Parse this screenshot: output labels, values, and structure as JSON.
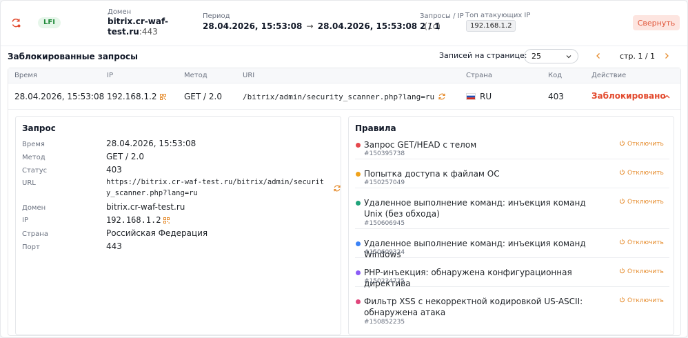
{
  "header": {
    "attack_type": "LFI",
    "domain_label": "Домен",
    "domain_name": "bitrix.cr-waf-test.ru",
    "domain_port": ":443",
    "period_label": "Период",
    "period_start": "28.04.2026, 15:53:08",
    "period_arrow": "→",
    "period_end": "28.04.2026, 15:53:08",
    "period_duration": "(1с)",
    "requests_label": "Запросы / IP",
    "requests_value": "2 / 1",
    "top_ip_label": "Топ атакующих IP",
    "top_ip": "192.168.1.2",
    "collapse_button": "Свернуть"
  },
  "blocked": {
    "title": "Заблокированные запросы",
    "per_page_label": "Записей на странице:",
    "per_page_value": "25",
    "page_text": "стр. 1 / 1"
  },
  "table": {
    "columns": [
      "Время",
      "IP",
      "Метод",
      "URI",
      "Страна",
      "Код",
      "Действие"
    ],
    "row": {
      "time": "28.04.2026, 15:53:08",
      "ip": "192.168.1.2",
      "method": "GET / 2.0",
      "uri": "/bitrix/admin/security_scanner.php?lang=ru",
      "country": "RU",
      "code": "403",
      "action": "Заблокировано"
    }
  },
  "request_panel": {
    "title": "Запрос",
    "fields": [
      {
        "key": "Время",
        "value": "28.04.2026, 15:53:08"
      },
      {
        "key": "Метод",
        "value": "GET / 2.0"
      },
      {
        "key": "Статус",
        "value": "403"
      },
      {
        "key": "URL",
        "value": "https://bitrix.cr-waf-test.ru/bitrix/admin/security_scanner.php?lang=ru"
      },
      {
        "key": "Домен",
        "value": "bitrix.cr-waf-test.ru"
      },
      {
        "key": "IP",
        "value": "192.168.1.2"
      },
      {
        "key": "Страна",
        "value": "Российская Федерация"
      },
      {
        "key": "Порт",
        "value": "443"
      }
    ]
  },
  "rules_panel": {
    "title": "Правила",
    "disable_label": "Отключить",
    "rules": [
      {
        "name": "Запрос GET/HEAD с телом",
        "id": "#150395738",
        "color": "#e5484d"
      },
      {
        "name": "Попытка доступа к файлам ОС",
        "id": "#150257049",
        "color": "#f0a21b"
      },
      {
        "name": "Удаленное выполнение команд: инъекция команд Unix (без обхода)",
        "id": "#150606945",
        "color": "#1fa37a"
      },
      {
        "name": "Удаленное выполнение команд: инъекция команд Windows",
        "id": "#150609324",
        "color": "#3b82f6"
      },
      {
        "name": "PHP-инъекция: обнаружена конфигурационная директива",
        "id": "#150234725",
        "color": "#8b5cf6"
      },
      {
        "name": "Фильтр XSS с некорректной кодировкой US-ASCII: обнаружена атака",
        "id": "#150852235",
        "color": "#e0457b"
      }
    ]
  },
  "colors": {
    "accent": "#e24a2e",
    "orange": "#e58a2a",
    "badge_green": "#1f8a3a"
  },
  "icons": [
    "sync-alert-icon",
    "chevron-down-icon",
    "chevron-left-icon",
    "chevron-right-icon",
    "qr-icon",
    "refresh-icon",
    "russia-flag-icon",
    "chevron-up-icon",
    "disable-icon"
  ]
}
